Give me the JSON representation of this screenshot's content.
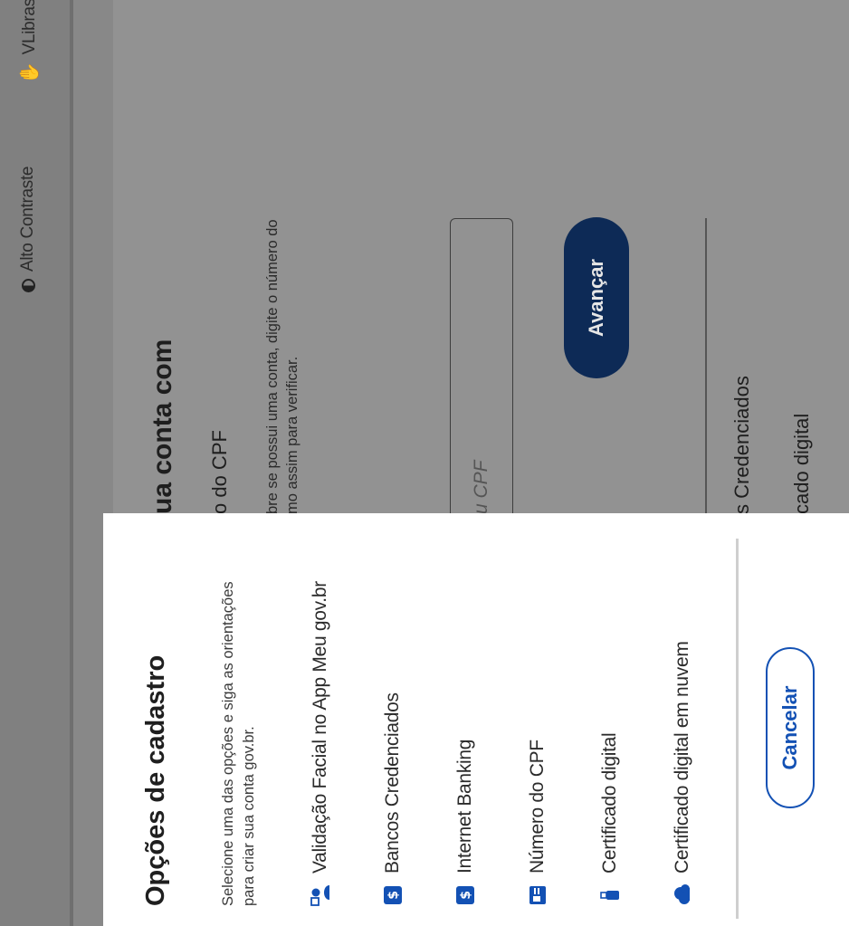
{
  "topbar": {
    "contrast_label": "Alto Contraste",
    "vlibras_label": "VLibras"
  },
  "background_page": {
    "title_partial": "ua conta com",
    "subtitle_partial": "o do CPF",
    "description_partial": "bre se possui uma conta, digite o número do mo assim para verificar.",
    "cpf_placeholder_partial": "u CPF",
    "advance_button": "Avançar",
    "option_partial_1": "s Credenciados",
    "option_partial_2": "cado digital"
  },
  "modal": {
    "title": "Opções de cadastro",
    "description": "Selecione uma das opções e siga as orientações para criar sua conta gov.br.",
    "options": [
      {
        "label": "Validação Facial no App Meu gov.br",
        "icon": "face-id-icon"
      },
      {
        "label": "Bancos Credenciados",
        "icon": "bank-icon"
      },
      {
        "label": "Internet Banking",
        "icon": "internet-banking-icon"
      },
      {
        "label": "Número do CPF",
        "icon": "id-card-icon"
      },
      {
        "label": "Certificado digital",
        "icon": "usb-token-icon"
      },
      {
        "label": "Certificado digital em nuvem",
        "icon": "cloud-certificate-icon"
      }
    ],
    "cancel_button": "Cancelar"
  },
  "colors": {
    "primary_blue": "#1351b4",
    "dark_blue_button": "#0d2a56",
    "overlay_gray": "#888888"
  }
}
